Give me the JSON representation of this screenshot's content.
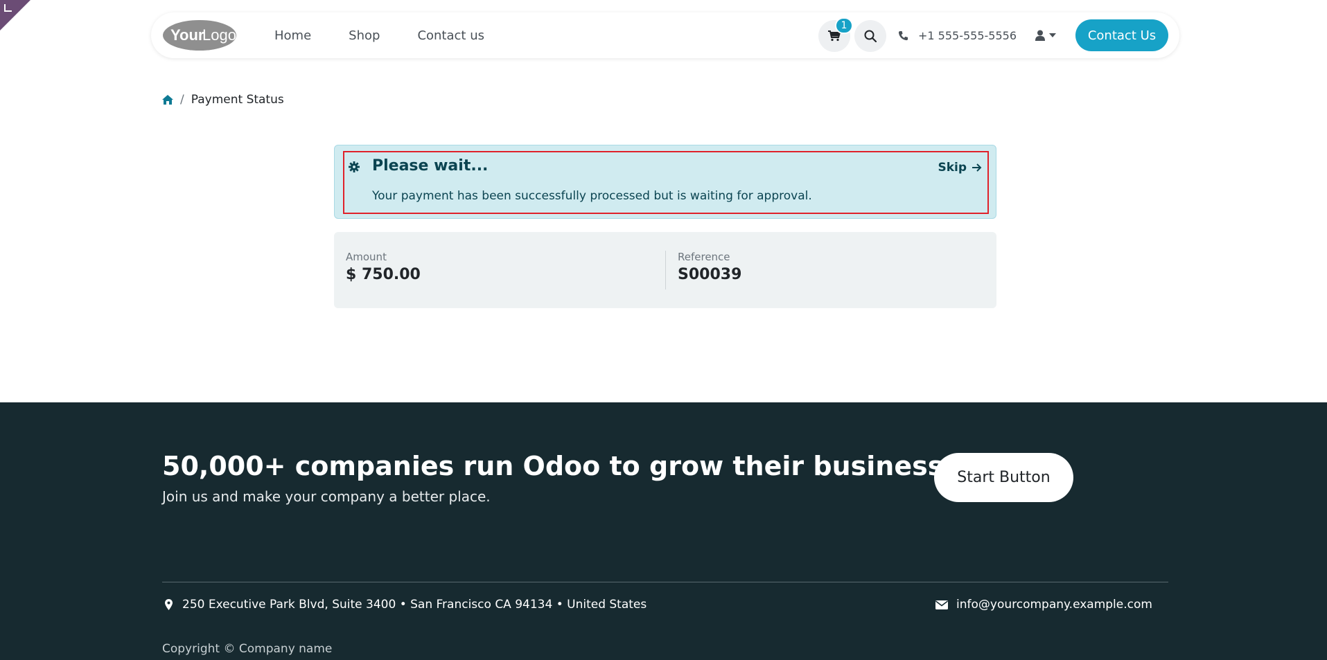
{
  "nav": {
    "logo_text": "YourLogo",
    "links": [
      "Home",
      "Shop",
      "Contact us"
    ],
    "cart_count": "1",
    "phone": "+1 555-555-5556",
    "contact_button": "Contact Us"
  },
  "breadcrumb": {
    "current": "Payment Status"
  },
  "alert": {
    "title": "Please wait...",
    "message": "Your payment has been successfully processed but is waiting for approval.",
    "skip_label": "Skip"
  },
  "payment": {
    "amount_label": "Amount",
    "amount_value": "$ 750.00",
    "reference_label": "Reference",
    "reference_value": "S00039"
  },
  "footer": {
    "headline": "50,000+ companies run Odoo to grow their businesses.",
    "subline": "Join us and make your company a better place.",
    "start_button": "Start Button",
    "address": "250 Executive Park Blvd, Suite 3400 • San Francisco CA 94134 • United States",
    "email": "info@yourcompany.example.com",
    "copyright": "Copyright © Company name"
  },
  "colors": {
    "accent": "#17a2c7",
    "alert_bg": "#d0ebf0",
    "footer_bg": "#172a30"
  }
}
